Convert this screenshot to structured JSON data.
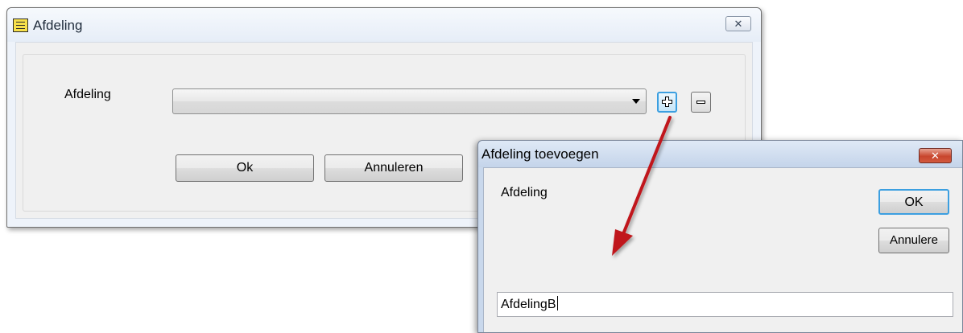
{
  "main_dialog": {
    "title": "Afdeling",
    "icon": "list-window-icon",
    "close_glyph": "✕",
    "field_label": "Afdeling",
    "combo_value": "",
    "ok_label": "Ok",
    "cancel_label": "Annuleren",
    "add_icon": "plus-icon",
    "remove_icon": "minus-icon"
  },
  "add_dialog": {
    "title": "Afdeling toevoegen",
    "close_glyph": "✕",
    "field_label": "Afdeling",
    "ok_label": "OK",
    "cancel_label": "Annulere",
    "input_value": "AfdelingB"
  },
  "colors": {
    "accent_focus": "#3c9fe0",
    "arrow": "#c0161b",
    "close_red": "#c8452d"
  }
}
